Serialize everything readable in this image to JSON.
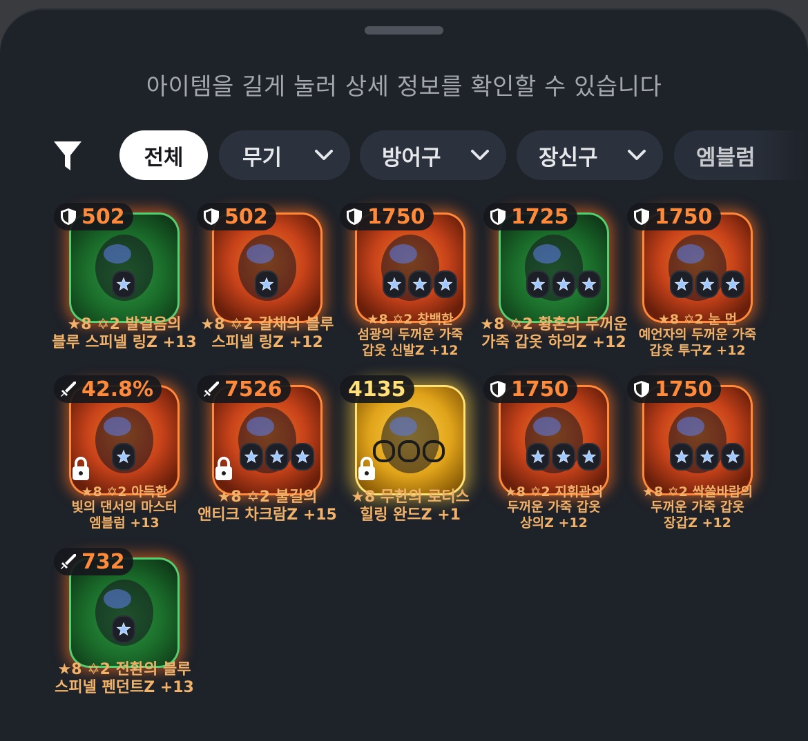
{
  "hint": "아이템을 길게 눌러 상세 정보를 확인할 수 있습니다",
  "filters": {
    "all": "전체",
    "weapon": "무기",
    "armor": "방어구",
    "accessory": "장신구",
    "emblem": "엠블럼"
  },
  "items": [
    {
      "value": "502",
      "type": "defense",
      "name1": "★8 ✡2 발걸음의",
      "name2": "블루 스피넬 링Z +13",
      "frame": "green",
      "sockets": 1
    },
    {
      "value": "502",
      "type": "defense",
      "name1": "★8 ✡2 갈채의 블루",
      "name2": "스피넬 링Z +12",
      "frame": "orange",
      "sockets": 1
    },
    {
      "value": "1750",
      "type": "defense",
      "name1": "★8 ✡2 창백한",
      "name2": "섬광의 두꺼운 가죽",
      "name3": "갑옷 신발Z +12",
      "frame": "orange",
      "sockets": 3
    },
    {
      "value": "1725",
      "type": "defense",
      "name1": "★8 ✡2 황혼의 두꺼운",
      "name2": "가죽 갑옷 하의Z +12",
      "frame": "green",
      "sockets": 3
    },
    {
      "value": "1750",
      "type": "defense",
      "name1": "★8 ✡2 눈 먼",
      "name2": "예언자의 두꺼운 가죽",
      "name3": "갑옷 투구Z +12",
      "frame": "orange",
      "sockets": 3
    },
    {
      "value": "42.8%",
      "type": "attack",
      "name1": "★8 ✡2 아득한",
      "name2": "빛의 댄서의 마스터",
      "name3": "엠블럼 +13",
      "frame": "orange",
      "sockets": 1,
      "locked": true
    },
    {
      "value": "7526",
      "type": "attack",
      "name1": "★8 ✡2 불길의",
      "name2": "앤티크 차크람Z +15",
      "frame": "orange",
      "sockets": 3,
      "locked": true
    },
    {
      "value": "4135",
      "type": "plain",
      "name1": "★8 무한의 로터스",
      "name2": "힐링 완드Z +1",
      "frame": "gold",
      "sockets": 0,
      "locked": true
    },
    {
      "value": "1750",
      "type": "defense",
      "name1": "★8 ✡2 지휘관의",
      "name2": "두꺼운 가죽 갑옷",
      "name3": "상의Z +12",
      "frame": "orange",
      "sockets": 3
    },
    {
      "value": "1750",
      "type": "defense",
      "name1": "★8 ✡2 싹쓸바람의",
      "name2": "두꺼운 가죽 갑옷",
      "name3": "장갑Z +12",
      "frame": "orange",
      "sockets": 3
    },
    {
      "value": "732",
      "type": "attack",
      "name1": "★8 ✡2 전환의 블루",
      "name2": "스피넬 펜던트Z +13",
      "frame": "green",
      "sockets": 1
    }
  ],
  "colors": {
    "accent_orange": "#ff8a3c",
    "name_text": "#f2b26a",
    "sheet_bg": "#1e2229"
  },
  "icons": [
    "filter-icon",
    "chevron-down-icon",
    "shield-icon",
    "sword-icon",
    "lock-icon",
    "star-socket-icon"
  ]
}
